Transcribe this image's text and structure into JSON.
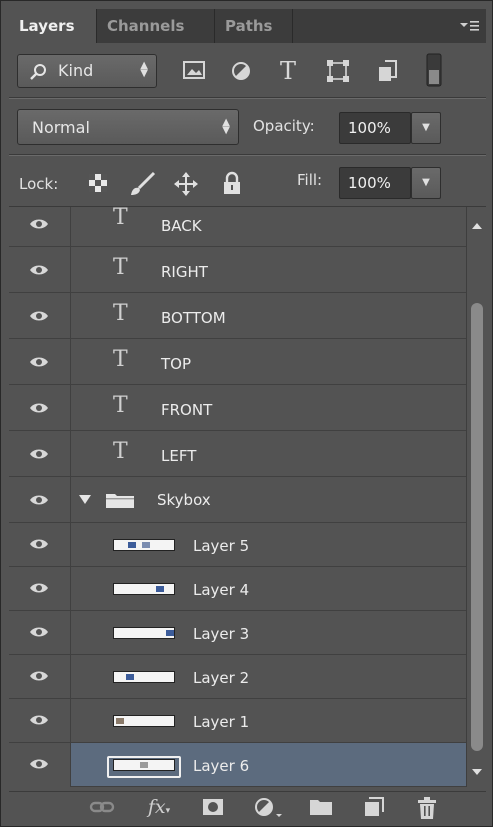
{
  "tabs": [
    {
      "label": "Layers",
      "active": true
    },
    {
      "label": "Channels",
      "active": false
    },
    {
      "label": "Paths",
      "active": false
    }
  ],
  "filter": {
    "kind_label": "Kind"
  },
  "blend": {
    "mode": "Normal",
    "opacity_label": "Opacity:",
    "opacity_value": "100%"
  },
  "lock": {
    "label": "Lock:",
    "fill_label": "Fill:",
    "fill_value": "100%"
  },
  "layers": [
    {
      "name": "BACK",
      "type": "text"
    },
    {
      "name": "RIGHT",
      "type": "text"
    },
    {
      "name": "BOTTOM",
      "type": "text"
    },
    {
      "name": "TOP",
      "type": "text"
    },
    {
      "name": "FRONT",
      "type": "text"
    },
    {
      "name": "LEFT",
      "type": "text"
    },
    {
      "name": "Skybox",
      "type": "group"
    },
    {
      "name": "Layer 5",
      "type": "pixel"
    },
    {
      "name": "Layer 4",
      "type": "pixel"
    },
    {
      "name": "Layer 3",
      "type": "pixel"
    },
    {
      "name": "Layer 2",
      "type": "pixel"
    },
    {
      "name": "Layer 1",
      "type": "pixel"
    },
    {
      "name": "Layer 6",
      "type": "pixel",
      "selected": true
    }
  ],
  "colors": {
    "panel": "#535353",
    "tabbar": "#3c3c3c",
    "selected": "#5c6b7e",
    "thumb_accent": "#3c5c9a"
  }
}
